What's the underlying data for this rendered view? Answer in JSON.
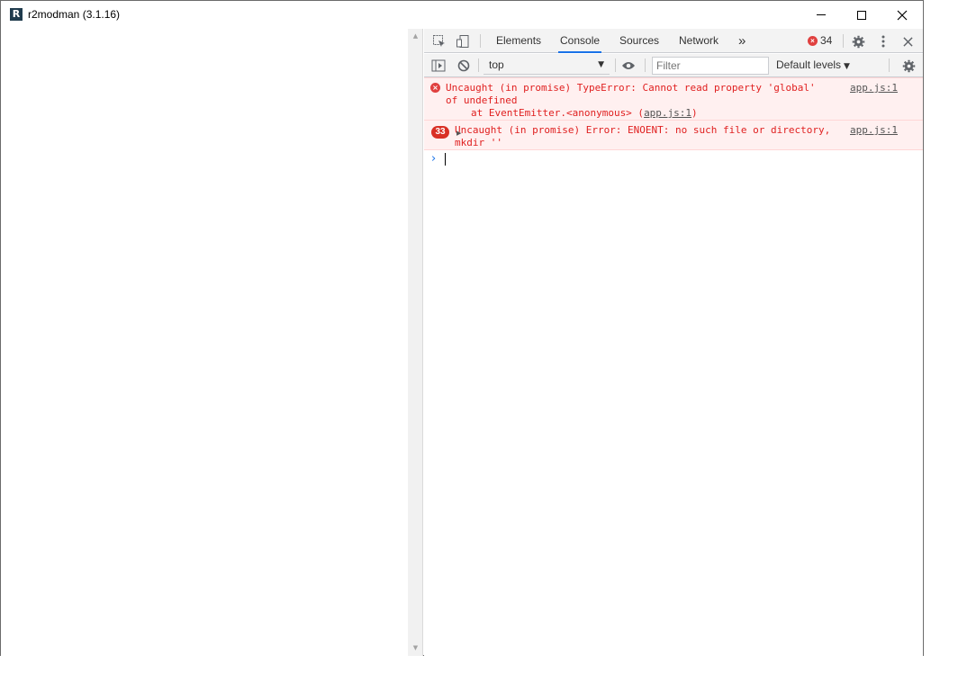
{
  "window": {
    "title": "r2modman (3.1.16)",
    "icon_letter": "R"
  },
  "devtools": {
    "tabs": [
      "Elements",
      "Console",
      "Sources",
      "Network"
    ],
    "active_tab": "Console",
    "more_tabs_glyph": "»",
    "error_count": "34",
    "console_toolbar": {
      "context": "top",
      "filter_placeholder": "Filter",
      "levels": "Default levels"
    },
    "messages": [
      {
        "text": "Uncaught (in promise) TypeError: Cannot read property 'global' of undefined",
        "source": "app.js:1",
        "stack_prefix": "at EventEmitter.<anonymous> (",
        "stack_link": "app.js:1",
        "stack_suffix": ")"
      },
      {
        "repeat_count": "33",
        "text": "Uncaught (in promise) Error: ENOENT: no such file or directory, mkdir ''",
        "source": "app.js:1"
      }
    ],
    "prompt_glyph": "›"
  },
  "colors": {
    "error_text": "#e02020",
    "error_background": "#fff0f0",
    "accent": "#1a73e8"
  }
}
